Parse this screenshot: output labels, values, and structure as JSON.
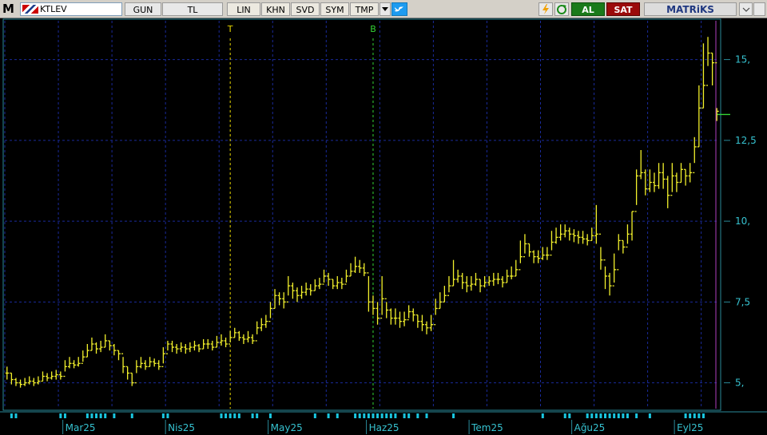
{
  "toolbar": {
    "logo": "M",
    "symbol": "KTLEV",
    "period": "GUN",
    "currency": "TL",
    "scale_buttons": [
      "LIN",
      "KHN",
      "SVD",
      "SYM",
      "TMP"
    ],
    "buy_label": "AL",
    "sell_label": "SAT",
    "brand": "MATRiKS",
    "icons": [
      "twitter-icon",
      "lightning-icon",
      "refresh-icon",
      "dropdown-icon"
    ]
  },
  "colors": {
    "background": "#000000",
    "grid": "#1a2a9a",
    "axis": "#2a8a9a",
    "axis_text": "#36c2d0",
    "bars": "#f2f02c",
    "marker_t": "#e8d800",
    "marker_b": "#35d435",
    "last_price_line": "#35d435",
    "cursor_line": "#b040c0",
    "volume_ticks": "#19c7e0",
    "al": "#1a7a1a",
    "sat": "#9b0b0b"
  },
  "chart_data": {
    "type": "ohlc",
    "y_axis": {
      "range": [
        4.2,
        16.2
      ],
      "tick_labels": [
        "5,",
        "7,5",
        "10,",
        "12,5",
        "15,"
      ],
      "tick_values": [
        5,
        7.5,
        10,
        12.5,
        15
      ]
    },
    "x_axis": {
      "labels": [
        "Mar25",
        "Nis25",
        "May25",
        "Haz25",
        "Tem25",
        "Ağu25",
        "Eyl25"
      ],
      "label_session_index": [
        13,
        36,
        59,
        81,
        104,
        127,
        150
      ]
    },
    "markers": [
      {
        "label": "T",
        "session_index": 50
      },
      {
        "label": "B",
        "session_index": 82
      }
    ],
    "last_price": 13.3,
    "close": [
      5.3,
      5.1,
      5.0,
      4.95,
      5.0,
      5.05,
      5.0,
      5.05,
      5.2,
      5.15,
      5.2,
      5.25,
      5.2,
      5.5,
      5.6,
      5.55,
      5.6,
      5.8,
      6.0,
      6.2,
      6.05,
      6.1,
      6.3,
      6.15,
      6.0,
      5.9,
      5.5,
      5.3,
      5.0,
      5.5,
      5.6,
      5.5,
      5.65,
      5.6,
      5.5,
      5.9,
      6.2,
      6.1,
      6.05,
      6.1,
      6.05,
      6.1,
      6.15,
      6.05,
      6.2,
      6.2,
      6.1,
      6.25,
      6.3,
      6.2,
      6.4,
      6.55,
      6.4,
      6.35,
      6.4,
      6.3,
      6.7,
      6.8,
      6.9,
      7.3,
      7.7,
      7.6,
      7.5,
      8.0,
      7.85,
      7.7,
      7.8,
      7.9,
      7.85,
      8.0,
      8.05,
      8.3,
      8.2,
      8.0,
      8.1,
      8.05,
      8.3,
      8.45,
      8.6,
      8.55,
      8.4,
      7.5,
      7.3,
      7.0,
      7.6,
      7.25,
      7.0,
      7.0,
      6.9,
      6.95,
      7.2,
      7.1,
      6.9,
      6.8,
      6.7,
      6.8,
      7.3,
      7.5,
      7.7,
      8.0,
      8.2,
      8.3,
      8.1,
      8.0,
      8.05,
      8.2,
      8.0,
      8.1,
      8.15,
      8.2,
      8.2,
      8.1,
      8.3,
      8.3,
      8.5,
      8.9,
      9.3,
      9.05,
      8.9,
      8.85,
      8.95,
      8.95,
      9.35,
      9.5,
      9.6,
      9.7,
      9.6,
      9.55,
      9.5,
      9.45,
      9.4,
      9.55,
      9.6,
      8.8,
      8.3,
      8.0,
      8.5,
      9.4,
      9.2,
      9.6,
      10.3,
      11.4,
      11.5,
      11.0,
      11.2,
      11.1,
      11.5,
      11.3,
      10.8,
      11.4,
      11.2,
      11.6,
      11.4,
      11.5,
      12.3,
      13.5,
      14.2,
      15.2,
      14.9,
      13.4
    ],
    "high": [
      5.5,
      5.3,
      5.15,
      5.1,
      5.15,
      5.2,
      5.15,
      5.2,
      5.35,
      5.3,
      5.35,
      5.4,
      5.35,
      5.7,
      5.8,
      5.7,
      5.8,
      6.0,
      6.2,
      6.4,
      6.25,
      6.3,
      6.5,
      6.3,
      6.2,
      6.0,
      5.8,
      5.5,
      5.3,
      5.7,
      5.8,
      5.7,
      5.8,
      5.75,
      5.7,
      6.1,
      6.3,
      6.3,
      6.2,
      6.25,
      6.2,
      6.25,
      6.3,
      6.2,
      6.35,
      6.35,
      6.3,
      6.45,
      6.5,
      6.4,
      6.6,
      6.7,
      6.6,
      6.5,
      6.6,
      6.5,
      6.9,
      7.0,
      7.1,
      7.5,
      7.9,
      7.8,
      7.8,
      8.3,
      8.1,
      7.95,
      8.0,
      8.1,
      8.05,
      8.2,
      8.25,
      8.5,
      8.4,
      8.2,
      8.3,
      8.25,
      8.5,
      8.7,
      8.9,
      8.8,
      8.7,
      8.3,
      7.7,
      7.5,
      8.3,
      7.5,
      7.3,
      7.3,
      7.2,
      7.2,
      7.4,
      7.3,
      7.1,
      7.1,
      6.9,
      7.1,
      7.6,
      7.8,
      8.0,
      8.3,
      8.8,
      8.5,
      8.4,
      8.3,
      8.3,
      8.4,
      8.2,
      8.3,
      8.3,
      8.4,
      8.4,
      8.3,
      8.5,
      8.6,
      8.8,
      9.4,
      9.6,
      9.3,
      9.1,
      9.1,
      9.2,
      9.2,
      9.7,
      9.8,
      9.9,
      9.9,
      9.8,
      9.75,
      9.7,
      9.7,
      9.6,
      9.8,
      10.5,
      9.2,
      8.6,
      8.4,
      9.0,
      9.6,
      9.4,
      9.9,
      10.3,
      11.6,
      12.2,
      11.6,
      11.6,
      11.5,
      11.8,
      11.8,
      11.4,
      11.8,
      11.5,
      11.8,
      11.6,
      11.8,
      12.6,
      14.2,
      15.5,
      15.7,
      15.2,
      13.5
    ],
    "low": [
      5.1,
      4.95,
      4.9,
      4.85,
      4.9,
      4.95,
      4.9,
      4.95,
      5.05,
      5.05,
      5.1,
      5.1,
      5.1,
      5.35,
      5.45,
      5.45,
      5.5,
      5.65,
      5.8,
      6.0,
      5.9,
      5.95,
      6.1,
      6.0,
      5.85,
      5.7,
      5.3,
      5.1,
      4.9,
      5.3,
      5.45,
      5.4,
      5.5,
      5.5,
      5.4,
      5.6,
      6.0,
      5.95,
      5.9,
      5.95,
      5.9,
      5.95,
      6.0,
      5.95,
      6.05,
      6.05,
      6.0,
      6.1,
      6.15,
      6.1,
      6.25,
      6.4,
      6.3,
      6.2,
      6.25,
      6.2,
      6.5,
      6.6,
      6.7,
      7.0,
      7.3,
      7.4,
      7.3,
      7.7,
      7.6,
      7.5,
      7.6,
      7.7,
      7.7,
      7.85,
      7.9,
      8.1,
      8.0,
      7.9,
      7.9,
      7.9,
      8.1,
      8.3,
      8.4,
      8.4,
      8.3,
      7.2,
      7.1,
      6.8,
      7.1,
      7.0,
      6.8,
      6.8,
      6.7,
      6.75,
      7.0,
      6.9,
      6.7,
      6.6,
      6.5,
      6.6,
      7.1,
      7.3,
      7.5,
      7.8,
      8.0,
      8.1,
      7.9,
      7.8,
      7.85,
      8.0,
      7.8,
      7.95,
      8.0,
      8.0,
      8.05,
      7.95,
      8.1,
      8.2,
      8.3,
      8.7,
      9.0,
      8.9,
      8.7,
      8.7,
      8.8,
      8.8,
      9.1,
      9.3,
      9.4,
      9.5,
      9.4,
      9.35,
      9.3,
      9.3,
      9.25,
      9.4,
      9.3,
      8.5,
      7.9,
      7.7,
      8.1,
      9.1,
      9.0,
      9.3,
      9.4,
      10.5,
      11.3,
      10.8,
      10.9,
      10.9,
      11.0,
      11.0,
      10.4,
      10.9,
      10.9,
      11.2,
      11.1,
      11.2,
      11.8,
      12.3,
      13.5,
      14.8,
      14.2,
      13.1
    ],
    "volume_marks": [
      0,
      1,
      1,
      0,
      0,
      0,
      0,
      0,
      0,
      0,
      0,
      0,
      1,
      1,
      0,
      0,
      0,
      0,
      1,
      1,
      1,
      1,
      1,
      0,
      1,
      0,
      0,
      0,
      1,
      0,
      0,
      0,
      0,
      0,
      0,
      1,
      1,
      0,
      0,
      0,
      0,
      0,
      0,
      0,
      0,
      0,
      0,
      0,
      1,
      1,
      1,
      1,
      1,
      0,
      0,
      1,
      1,
      0,
      0,
      1,
      0,
      0,
      0,
      0,
      0,
      0,
      0,
      0,
      0,
      1,
      0,
      0,
      1,
      0,
      1,
      0,
      0,
      0,
      1,
      1,
      1,
      1,
      1,
      1,
      1,
      1,
      1,
      1,
      0,
      1,
      1,
      0,
      1,
      0,
      1,
      0,
      0,
      0,
      0,
      0,
      1,
      0,
      0,
      0,
      0,
      0,
      0,
      0,
      0,
      0,
      0,
      0,
      0,
      0,
      0,
      0,
      0,
      0,
      0,
      0,
      1,
      0,
      0,
      0,
      0,
      1,
      1,
      0,
      0,
      0,
      1,
      1,
      1,
      1,
      1,
      1,
      1,
      1,
      1,
      1,
      0,
      1,
      0,
      0,
      1,
      0,
      0,
      0,
      0,
      0,
      0,
      0,
      1,
      1,
      1,
      1,
      1,
      0,
      0
    ]
  }
}
